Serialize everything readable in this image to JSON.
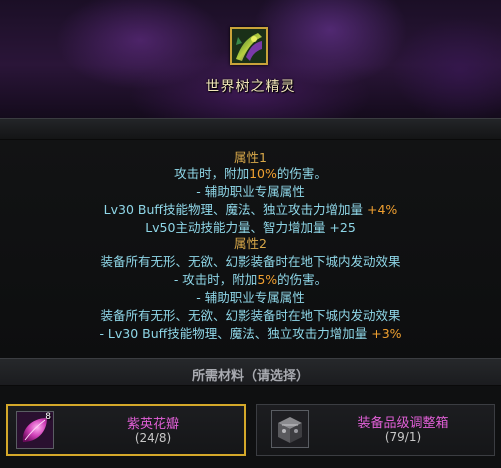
{
  "item": {
    "title": "世界树之精灵",
    "icon": "world-tree-spirit-icon"
  },
  "attributes": {
    "header1": "属性1",
    "line1_pre": "攻击时，附加",
    "line1_val": "10%",
    "line1_post": "的伤害。",
    "line2": "- 辅助职业专属属性",
    "line3_pre": "Lv30 Buff技能物理、魔法、独立攻击力增加量 ",
    "line3_val": "+4%",
    "line4": "Lv50主动技能力量、智力增加量 +25",
    "header2": "属性2",
    "line5": "装备所有无形、无欲、幻影装备时在地下城内发动效果",
    "line6_pre": "- 攻击时，附加",
    "line6_val": "5%",
    "line6_post": "的伤害。",
    "line7": "- 辅助职业专属属性",
    "line8": "装备所有无形、无欲、幻影装备时在地下城内发动效果",
    "line9_pre": "- Lv30 Buff技能物理、魔法、独立攻击力增加量 ",
    "line9_val": "+3%"
  },
  "materials": {
    "title": "所需材料（请选择）",
    "items": [
      {
        "name": "紫英花瓣",
        "count": "(24/8)",
        "badge": "8",
        "icon": "purple-petal-icon",
        "selected": true
      },
      {
        "name": "装备品级调整箱",
        "count": "(79/1)",
        "badge": "",
        "icon": "equipment-grade-box-icon",
        "selected": false
      }
    ]
  },
  "colors": {
    "frame_gold": "#d4a82a",
    "attr_text": "#8fd7e8",
    "attr_header": "#d8a84a",
    "highlight": "#f0a030",
    "material_name": "#e05fd6"
  }
}
